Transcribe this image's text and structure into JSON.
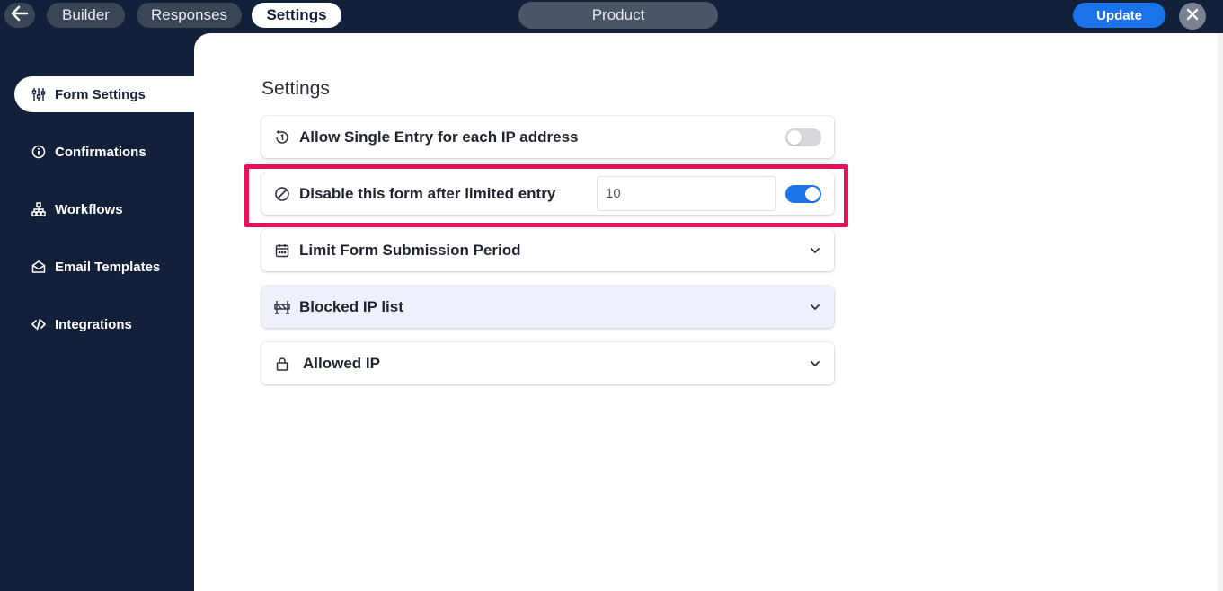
{
  "topbar": {
    "tabs": [
      {
        "label": "Builder",
        "active": false
      },
      {
        "label": "Responses",
        "active": false
      },
      {
        "label": "Settings",
        "active": true
      }
    ],
    "form_title": "Product",
    "update_label": "Update"
  },
  "sidebar": {
    "items": [
      {
        "label": "Form Settings",
        "icon": "sliders-icon",
        "active": true
      },
      {
        "label": "Confirmations",
        "icon": "info-circle-icon",
        "active": false
      },
      {
        "label": "Workflows",
        "icon": "sitemap-icon",
        "active": false
      },
      {
        "label": "Email Templates",
        "icon": "envelope-open-icon",
        "active": false
      },
      {
        "label": "Integrations",
        "icon": "code-icon",
        "active": false
      }
    ]
  },
  "main": {
    "section_title": "Settings",
    "cards": [
      {
        "label": "Allow Single Entry for each IP address",
        "icon": "single-entry-icon",
        "toggle": "off"
      },
      {
        "label": "Disable this form after limited entry",
        "icon": "ban-icon",
        "toggle": "on",
        "input_value": "10",
        "highlighted": true
      },
      {
        "label": "Limit Form Submission Period",
        "icon": "calendar-icon",
        "expandable": true
      },
      {
        "label": "Blocked IP list",
        "icon": "barrier-icon",
        "expandable": true
      },
      {
        "label": "Allowed IP",
        "icon": "lock-icon",
        "expandable": true
      }
    ]
  },
  "colors": {
    "sidebar_bg": "#13203a",
    "accent": "#1a73e8",
    "highlight_border": "#e8105a"
  }
}
